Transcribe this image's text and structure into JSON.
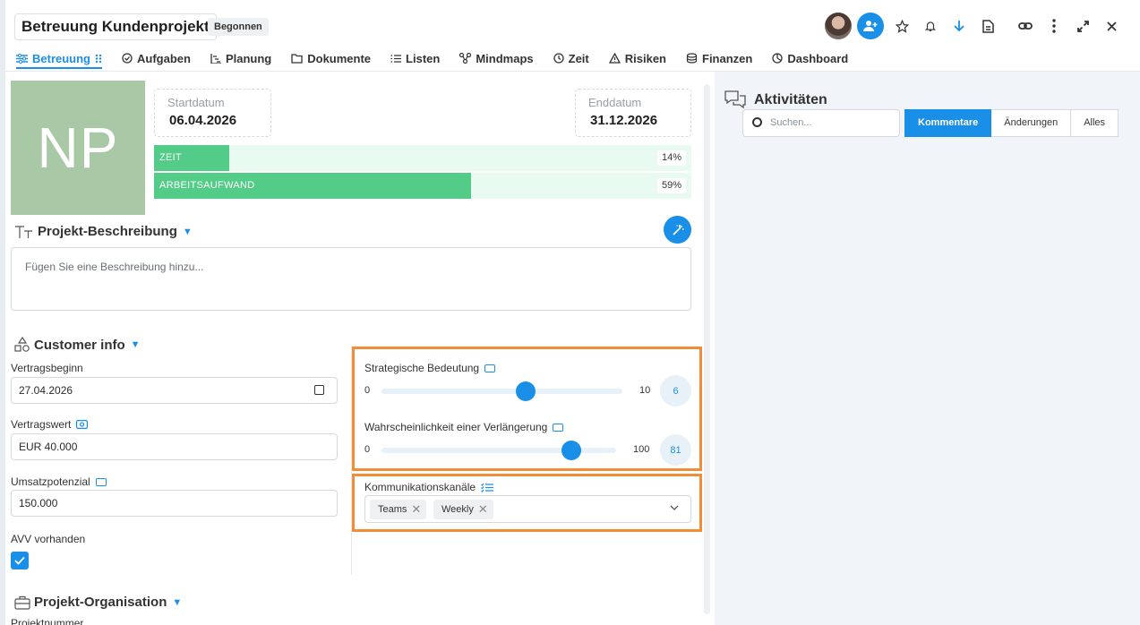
{
  "header": {
    "title": "Betreuung Kundenprojekt",
    "status": "Begonnen"
  },
  "tabs": [
    {
      "label": "Betreuung",
      "icon": "sliders-icon",
      "active": true
    },
    {
      "label": "Aufgaben",
      "icon": "check-circle-icon"
    },
    {
      "label": "Planung",
      "icon": "gantt-icon"
    },
    {
      "label": "Dokumente",
      "icon": "folder-icon"
    },
    {
      "label": "Listen",
      "icon": "list-icon"
    },
    {
      "label": "Mindmaps",
      "icon": "mindmap-icon"
    },
    {
      "label": "Zeit",
      "icon": "clock-icon"
    },
    {
      "label": "Risiken",
      "icon": "warning-icon"
    },
    {
      "label": "Finanzen",
      "icon": "coins-icon"
    },
    {
      "label": "Dashboard",
      "icon": "dashboard-icon"
    }
  ],
  "project": {
    "initials": "NP",
    "start_label": "Startdatum",
    "start_value": "06.04.2026",
    "end_label": "Enddatum",
    "end_value": "31.12.2026",
    "progress": [
      {
        "name": "ZEIT",
        "percent": 14,
        "percent_label": "14%"
      },
      {
        "name": "ARBEITSAUFWAND",
        "percent": 59,
        "percent_label": "59%"
      }
    ]
  },
  "description": {
    "title": "Projekt-Beschreibung",
    "placeholder": "Fügen Sie eine Beschreibung hinzu..."
  },
  "customer_info": {
    "title": "Customer info",
    "vertragsbeginn_label": "Vertragsbeginn",
    "vertragsbeginn_value": "27.04.2026",
    "vertragswert_label": "Vertragswert",
    "vertragswert_value": "EUR 40.000",
    "umsatzpotenzial_label": "Umsatzpotenzial",
    "umsatzpotenzial_value": "150.000",
    "avv_label": "AVV vorhanden",
    "avv_checked": true
  },
  "sliders": [
    {
      "label": "Strategische Bedeutung",
      "min": "0",
      "max": "10",
      "value": "6",
      "fraction": 0.6
    },
    {
      "label": "Wahrscheinlichkeit einer Verlängerung",
      "min": "0",
      "max": "100",
      "value": "81",
      "fraction": 0.81
    }
  ],
  "kanaele": {
    "label": "Kommunikationskanäle",
    "chips": [
      "Teams",
      "Weekly"
    ]
  },
  "organisation": {
    "title": "Projekt-Organisation",
    "first_field_label": "Projektnummer"
  },
  "activities": {
    "title": "Aktivitäten",
    "search_placeholder": "Suchen...",
    "filters": [
      "Kommentare",
      "Änderungen",
      "Alles"
    ],
    "active_filter": "Kommentare"
  },
  "colors": {
    "accent": "#1a8fe8",
    "progress_fill": "#52cc86",
    "highlight": "#f28c38"
  }
}
